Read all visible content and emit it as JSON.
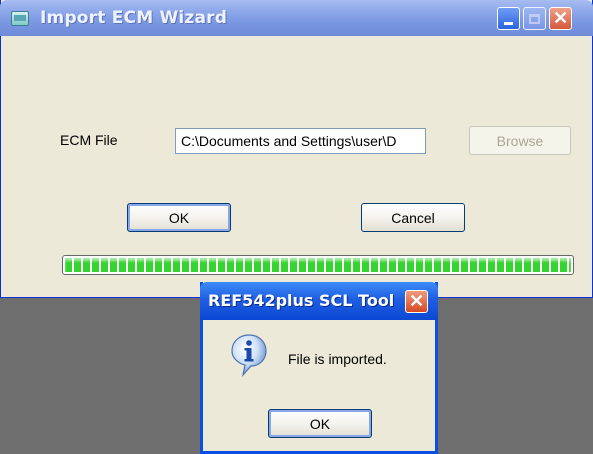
{
  "wizard": {
    "title": "Import ECM Wizard",
    "ecm_label": "ECM File",
    "ecm_file_value": "C:\\Documents and Settings\\user\\D",
    "browse_label": "Browse",
    "ok_label": "OK",
    "cancel_label": "Cancel",
    "progress": 1.0
  },
  "message_box": {
    "title": "REF542plus SCL Tool",
    "message": "File is imported.",
    "ok_label": "OK",
    "icon": "info-icon"
  },
  "colors": {
    "progress_green": "#36d430",
    "titlebar_active": "#0b48d4",
    "titlebar_inactive": "#7b98e2",
    "window_face": "#ece9d8"
  }
}
